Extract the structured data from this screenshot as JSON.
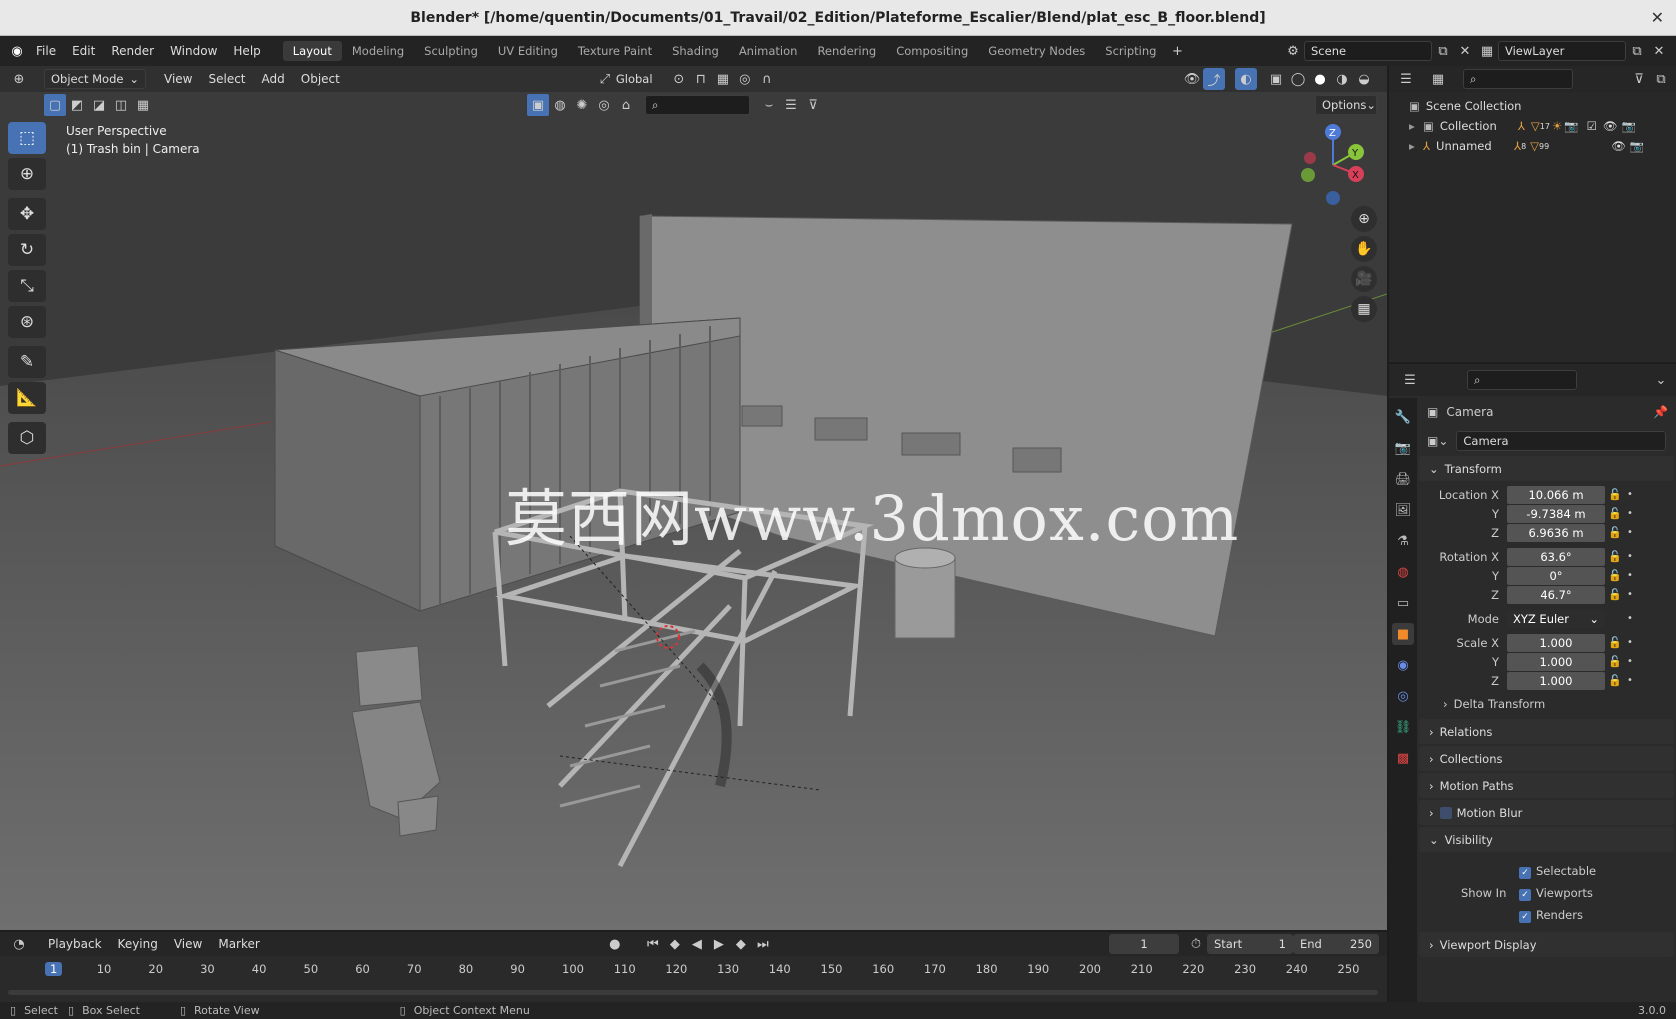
{
  "window": {
    "title": "Blender* [/home/quentin/Documents/01_Travail/02_Edition/Plateforme_Escalier/Blend/plat_esc_B_floor.blend]"
  },
  "menu": [
    "File",
    "Edit",
    "Render",
    "Window",
    "Help"
  ],
  "workspaces": [
    "Layout",
    "Modeling",
    "Sculpting",
    "UV Editing",
    "Texture Paint",
    "Shading",
    "Animation",
    "Rendering",
    "Compositing",
    "Geometry Nodes",
    "Scripting"
  ],
  "active_workspace": "Layout",
  "scene": {
    "name": "Scene",
    "view_layer": "ViewLayer"
  },
  "viewport": {
    "mode": "Object Mode",
    "menus": [
      "View",
      "Select",
      "Add",
      "Object"
    ],
    "orientation": "Global",
    "options_label": "Options",
    "perspective": "User Perspective",
    "active": "(1) Trash bin | Camera",
    "watermark": "莫西网www.3dmox.com",
    "axes": {
      "x": "X",
      "y": "Y",
      "z": "Z"
    }
  },
  "outliner": {
    "root": "Scene Collection",
    "items": [
      {
        "name": "Collection",
        "count_a": "17",
        "count_b": ""
      },
      {
        "name": "Unnamed",
        "count_a": "8",
        "count_b": "99"
      }
    ]
  },
  "properties": {
    "object_name": "Camera",
    "data_name": "Camera",
    "transform_label": "Transform",
    "location": {
      "label": "Location X",
      "x": "10.066 m",
      "y": "-9.7384 m",
      "z": "6.9636 m"
    },
    "rotation": {
      "label": "Rotation X",
      "x": "63.6°",
      "y": "0°",
      "z": "46.7°"
    },
    "mode_label": "Mode",
    "mode_value": "XYZ Euler",
    "scale": {
      "label": "Scale X",
      "x": "1.000",
      "y": "1.000",
      "z": "1.000"
    },
    "axis_y": "Y",
    "axis_z": "Z",
    "delta_transform": "Delta Transform",
    "panels": [
      "Relations",
      "Collections",
      "Motion Paths",
      "Motion Blur"
    ],
    "visibility": "Visibility",
    "selectable": "Selectable",
    "show_in": "Show In",
    "viewports": "Viewports",
    "renders": "Renders",
    "viewport_display": "Viewport Display"
  },
  "timeline": {
    "menus": [
      "Playback",
      "Keying",
      "View",
      "Marker"
    ],
    "current_frame": "1",
    "start_label": "Start",
    "start": "1",
    "end_label": "End",
    "end": "250",
    "ticks": [
      "1",
      "10",
      "20",
      "30",
      "40",
      "50",
      "60",
      "70",
      "80",
      "90",
      "100",
      "110",
      "120",
      "130",
      "140",
      "150",
      "160",
      "170",
      "180",
      "190",
      "200",
      "210",
      "220",
      "230",
      "240",
      "250"
    ]
  },
  "status": {
    "select": "Select",
    "box_select": "Box Select",
    "rotate_view": "Rotate View",
    "context_menu": "Object Context Menu",
    "version": "3.0.0"
  }
}
